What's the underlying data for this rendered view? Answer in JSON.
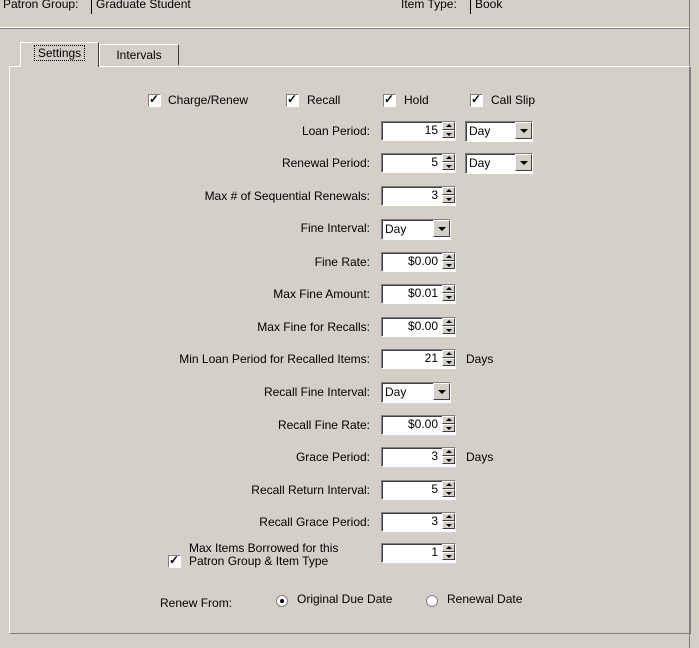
{
  "header": {
    "patron_group_label": "Patron Group:",
    "patron_group_value": "Graduate Student",
    "item_type_label": "Item Type:",
    "item_type_value": "Book"
  },
  "tabs": [
    {
      "label": "Settings"
    },
    {
      "label": "Intervals"
    }
  ],
  "checks": {
    "charge_renew": "Charge/Renew",
    "recall": "Recall",
    "hold": "Hold",
    "call_slip": "Call Slip"
  },
  "fields": {
    "loan_period_label": "Loan Period:",
    "loan_period_value": "15",
    "loan_period_unit": "Day",
    "renewal_period_label": "Renewal Period:",
    "renewal_period_value": "5",
    "renewal_period_unit": "Day",
    "max_seq_renewals_label": "Max # of Sequential Renewals:",
    "max_seq_renewals_value": "3",
    "fine_interval_label": "Fine Interval:",
    "fine_interval_value": "Day",
    "fine_rate_label": "Fine Rate:",
    "fine_rate_value": "$0.00",
    "max_fine_amount_label": "Max Fine Amount:",
    "max_fine_amount_value": "$0.01",
    "max_fine_recalls_label": "Max Fine for Recalls:",
    "max_fine_recalls_value": "$0.00",
    "min_loan_recalled_label": "Min Loan Period for Recalled Items:",
    "min_loan_recalled_value": "21",
    "min_loan_recalled_unit": "Days",
    "recall_fine_interval_label": "Recall Fine Interval:",
    "recall_fine_interval_value": "Day",
    "recall_fine_rate_label": "Recall Fine Rate:",
    "recall_fine_rate_value": "$0.00",
    "grace_period_label": "Grace Period:",
    "grace_period_value": "3",
    "grace_period_unit": "Days",
    "recall_return_interval_label": "Recall Return Interval:",
    "recall_return_interval_value": "5",
    "recall_grace_period_label": "Recall Grace Period:",
    "recall_grace_period_value": "3",
    "max_items_line1": "Max Items Borrowed for this",
    "max_items_line2": "Patron Group & Item Type",
    "max_items_value": "1"
  },
  "renew_from": {
    "label": "Renew From:",
    "original_due_date": "Original Due Date",
    "renewal_date": "Renewal Date"
  }
}
